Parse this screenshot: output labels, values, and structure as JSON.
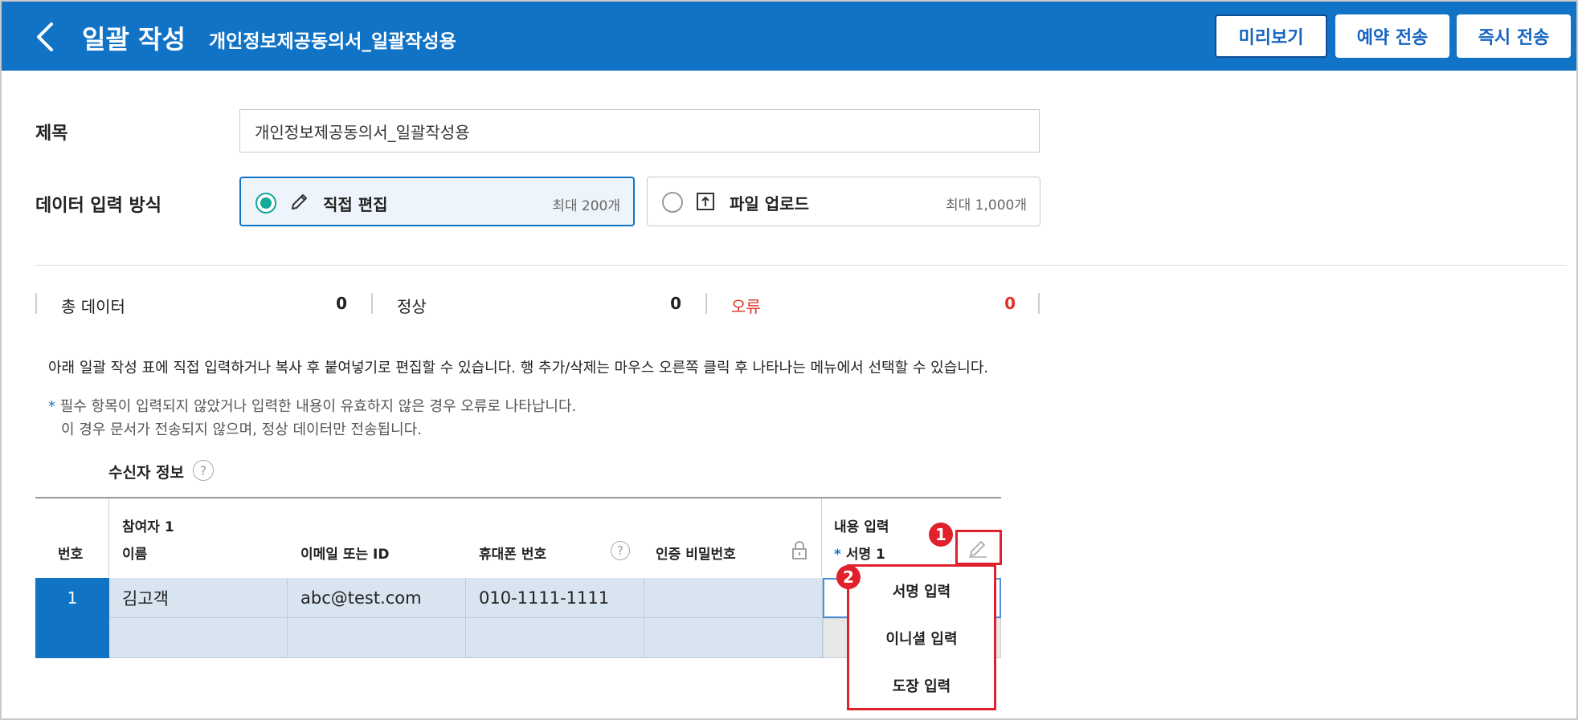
{
  "header": {
    "title": "일괄 작성",
    "subtitle": "개인정보제공동의서_일괄작성용",
    "buttons": {
      "preview": "미리보기",
      "reserve": "예약 전송",
      "now": "즉시 전송"
    },
    "bg_color": "#1173c6"
  },
  "form": {
    "title_label": "제목",
    "title_value": "개인정보제공동의서_일괄작성용",
    "mode_label": "데이터 입력 방식",
    "modes": [
      {
        "label": "직접 편집",
        "max": "최대 200개",
        "selected": true,
        "icon": "pencil-icon"
      },
      {
        "label": "파일 업로드",
        "max": "최대 1,000개",
        "selected": false,
        "icon": "upload-icon"
      }
    ]
  },
  "stats": {
    "total_label": "총 데이터",
    "total_value": "0",
    "ok_label": "정상",
    "ok_value": "0",
    "error_label": "오류",
    "error_value": "0"
  },
  "help": {
    "description": "아래 일괄 작성 표에 직접 입력하거나 복사 후 붙여넣기로 편집할 수 있습니다. 행 추가/삭제는 마우스 오른쪽 클릭 후 나타나는 메뉴에서 선택할 수 있습니다.",
    "note_star": "*",
    "note_line1": "필수 항목이 입력되지 않았거나 입력한 내용이 유효하지 않은 경우 오류로 나타납니다.",
    "note_line2": "이 경우 문서가 전송되지 않으며, 정상 데이터만 전송됩니다."
  },
  "table": {
    "section_title": "수신자 정보",
    "headers": {
      "num": "번호",
      "participant": "참여자 1",
      "name": "이름",
      "email": "이메일 또는 ID",
      "phone": "휴대폰 번호",
      "pin": "인증 비밀번호",
      "content": "내용 입력",
      "sign_star": "*",
      "sign": "서명 1"
    },
    "rows": [
      {
        "num": "1",
        "name": "김고객",
        "email": "abc@test.com",
        "phone": "010-1111-1111",
        "pin": ""
      },
      {
        "num": "",
        "name": "",
        "email": "",
        "phone": "",
        "pin": ""
      }
    ]
  },
  "annotations": {
    "badge1": "1",
    "badge2": "2"
  },
  "sign_menu": {
    "items": [
      "서명 입력",
      "이니셜 입력",
      "도장 입력"
    ]
  },
  "colors": {
    "primary": "#1173c6",
    "error": "#e03325",
    "radio": "#14a89b",
    "annotation": "#e0202a"
  }
}
